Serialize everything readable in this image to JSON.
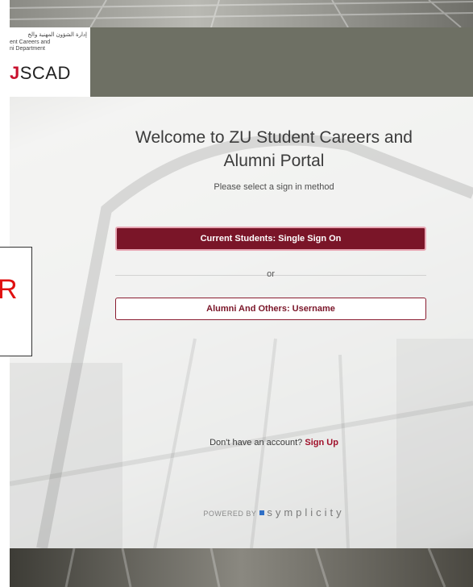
{
  "header": {
    "logo_arabic": "إدارة الشؤون المهنية والخ",
    "logo_english_line1": "ent Careers and",
    "logo_english_line2": "ni Department",
    "logo_mark_prefix": "J",
    "logo_mark_rest": "SCAD"
  },
  "main": {
    "title": "Welcome to ZU Student Careers and Alumni Portal",
    "subtitle": "Please select a sign in method",
    "primary_button": "Current Students: Single Sign On",
    "or_text": "or",
    "secondary_button": "Alumni And Others: Username",
    "signup_prompt": "Don't have an account?",
    "signup_link": "Sign Up",
    "powered_by": "POWERED BY",
    "powered_brand": "symplicity"
  },
  "overlay": {
    "letter": "R"
  },
  "colors": {
    "primary": "#7a1528",
    "header_bar": "#6e7064",
    "link": "#a0102a",
    "overlay_letter": "#e01010",
    "brand_square": "#2f6fc6"
  },
  "icons": {
    "brand": "symplicity-square-icon"
  }
}
